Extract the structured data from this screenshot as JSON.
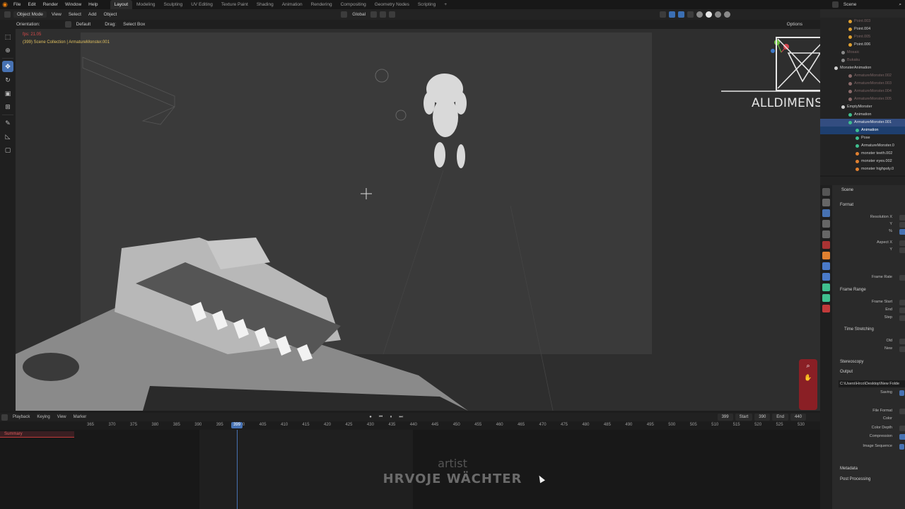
{
  "menu": [
    "File",
    "Edit",
    "Render",
    "Window",
    "Help"
  ],
  "workspaces": [
    {
      "label": "Layout",
      "active": true
    },
    {
      "label": "Modeling",
      "active": false
    },
    {
      "label": "Sculpting",
      "active": false
    },
    {
      "label": "UV Editing",
      "active": false
    },
    {
      "label": "Texture Paint",
      "active": false
    },
    {
      "label": "Shading",
      "active": false
    },
    {
      "label": "Animation",
      "active": false
    },
    {
      "label": "Rendering",
      "active": false
    },
    {
      "label": "Compositing",
      "active": false
    },
    {
      "label": "Geometry Nodes",
      "active": false
    },
    {
      "label": "Scripting",
      "active": false
    }
  ],
  "scene_name": "Scene",
  "viewport_header": {
    "mode": "Object Mode",
    "items": [
      "View",
      "Select",
      "Add",
      "Object"
    ],
    "transform_orientation": "Global",
    "options": "Options"
  },
  "viewport_subheader": {
    "orientation_label": "Orientation:",
    "orientation_value": "Default",
    "drag_label": "Drag:",
    "drag_value": "Select Box"
  },
  "viewport_overlay": {
    "fps": "fps: 21.05",
    "collection": "(399) Scene Collection | ArmatureMonster.001"
  },
  "watermark": "ALLDIMENSIONS",
  "timeline": {
    "menu": [
      "Playback",
      "Keying",
      "View",
      "Marker"
    ],
    "current_frame": "399",
    "start_label": "Start",
    "start_value": "390",
    "end_label": "End",
    "end_value": "440",
    "summary": "Summary",
    "ticks": [
      365,
      370,
      375,
      380,
      385,
      390,
      395,
      400,
      405,
      410,
      415,
      420,
      425,
      430,
      435,
      440,
      445,
      450,
      455,
      460,
      465,
      470,
      475,
      480,
      485,
      490,
      495,
      500,
      505,
      510,
      515,
      520,
      525,
      530
    ],
    "playhead": 399
  },
  "credit": {
    "role": "artist",
    "name": "HRVOJE WÄCHTER"
  },
  "outliner": {
    "rows": [
      {
        "label": "Point.003",
        "style": "dim",
        "indent": 2,
        "color": "#e0a030"
      },
      {
        "label": "Point.004",
        "style": "normal",
        "indent": 2,
        "color": "#e0a030"
      },
      {
        "label": "Point.005",
        "style": "dim",
        "indent": 2,
        "color": "#e0a030"
      },
      {
        "label": "Point.006",
        "style": "normal",
        "indent": 2,
        "color": "#e0a030"
      },
      {
        "label": "Mosaic",
        "style": "dim",
        "indent": 1,
        "color": "#8a8a8a"
      },
      {
        "label": "Bukaku",
        "style": "dim",
        "indent": 1,
        "color": "#8a8a8a"
      },
      {
        "label": "MonsterAnimation",
        "style": "normal",
        "indent": 0,
        "color": "#cfcfcf"
      },
      {
        "label": "ArmatureMonster.002",
        "style": "dim",
        "indent": 2,
        "color": "#8a6a6a"
      },
      {
        "label": "ArmatureMonster.003",
        "style": "dim",
        "indent": 2,
        "color": "#8a6a6a"
      },
      {
        "label": "ArmatureMonster.004",
        "style": "dim",
        "indent": 2,
        "color": "#8a6a6a"
      },
      {
        "label": "ArmatureMonster.005",
        "style": "dim",
        "indent": 2,
        "color": "#8a6a6a"
      },
      {
        "label": "EmptyMonster",
        "style": "normal",
        "indent": 1,
        "color": "#cfcfcf"
      },
      {
        "label": "Animation",
        "style": "normal",
        "indent": 2,
        "color": "#3fbf8f"
      },
      {
        "label": "ArmatureMonster.001",
        "style": "selected",
        "indent": 2,
        "color": "#3fbf8f"
      },
      {
        "label": "Animation",
        "style": "active",
        "indent": 3,
        "color": "#3fbf8f"
      },
      {
        "label": "Pose",
        "style": "normal",
        "indent": 3,
        "color": "#3fbf8f"
      },
      {
        "label": "ArmatureMonster.0",
        "style": "normal",
        "indent": 3,
        "color": "#3fbf8f"
      },
      {
        "label": "monster teeth.002",
        "style": "normal",
        "indent": 3,
        "color": "#e08030"
      },
      {
        "label": "monster eyes.002",
        "style": "normal",
        "indent": 3,
        "color": "#e08030"
      },
      {
        "label": "monster highpoly.0",
        "style": "normal",
        "indent": 3,
        "color": "#e08030"
      }
    ]
  },
  "properties": {
    "scene": "Scene",
    "format": "Format",
    "resolution_x": "Resolution X",
    "y1": "Y",
    "percent": "%",
    "aspect_x": "Aspect X",
    "y2": "Y",
    "frame_rate": "Frame Rate",
    "frame_range": "Frame Range",
    "frame_start": "Frame Start",
    "end": "End",
    "step": "Step",
    "time_stretching": "Time Stretching",
    "old": "Old",
    "new": "New",
    "stereoscopy": "Stereoscopy",
    "output": "Output",
    "output_path": "C:\\Users\\Hrco\\Desktop\\New Folde",
    "saving": "Saving",
    "file_format": "File Format",
    "color": "Color",
    "color_depth": "Color Depth",
    "compression": "Compression",
    "image_sequence": "Image Sequence",
    "metadata": "Metadata",
    "post_processing": "Post Processing"
  },
  "colors": {
    "accent": "#4772b3",
    "keyframe_summary": "#c23a3a"
  }
}
